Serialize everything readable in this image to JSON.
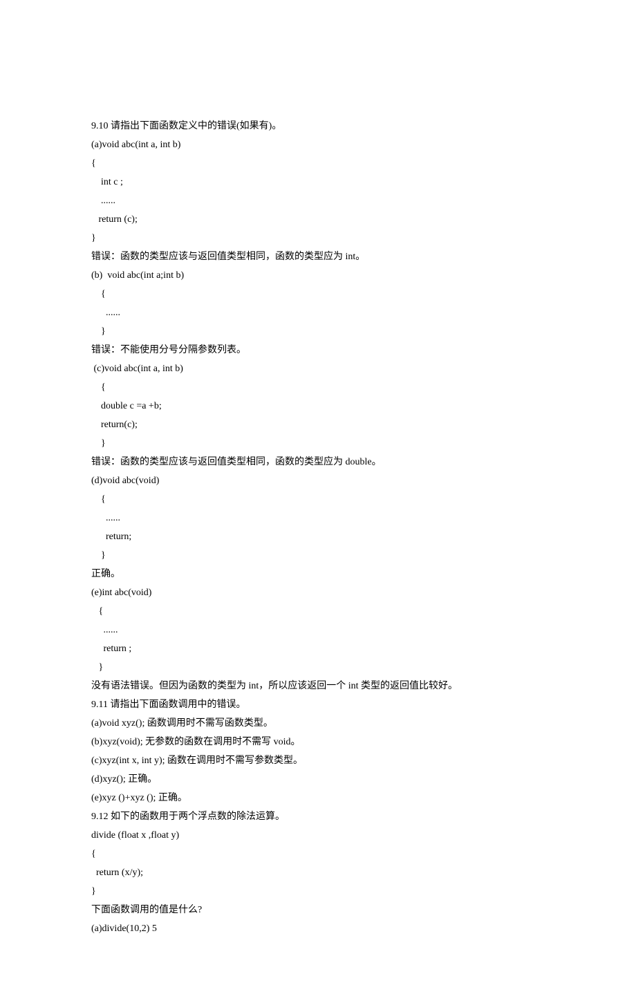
{
  "lines": [
    "9.10 请指出下面函数定义中的错误(如果有)。",
    "(a)void abc(int a, int b)",
    "{",
    "    int c ;",
    "    ......",
    "   return (c);",
    "}",
    "错误：函数的类型应该与返回值类型相同，函数的类型应为 int。",
    "(b)  void abc(int a;int b)",
    "    {",
    "      ......",
    "    }",
    "错误：不能使用分号分隔参数列表。",
    " (c)void abc(int a, int b)",
    "    {",
    "    double c =a +b;",
    "    return(c);",
    "    }",
    "错误：函数的类型应该与返回值类型相同，函数的类型应为 double。",
    "(d)void abc(void)",
    "    {",
    "      ......",
    "      return;",
    "    }",
    "正确。",
    "(e)int abc(void)",
    "   {",
    "     ......",
    "     return ;",
    "   }",
    "没有语法错误。但因为函数的类型为 int，所以应该返回一个 int 类型的返回值比较好。",
    "9.11 请指出下面函数调用中的错误。",
    "(a)void xyz(); 函数调用时不需写函数类型。",
    "(b)xyz(void); 无参数的函数在调用时不需写 void。",
    "(c)xyz(int x, int y); 函数在调用时不需写参数类型。",
    "(d)xyz(); 正确。",
    "(e)xyz ()+xyz (); 正确。",
    "9.12 如下的函数用于两个浮点数的除法运算。",
    "divide (float x ,float y)",
    "{",
    "  return (x/y);",
    "}",
    "下面函数调用的值是什么?",
    "(a)divide(10,2) 5"
  ]
}
